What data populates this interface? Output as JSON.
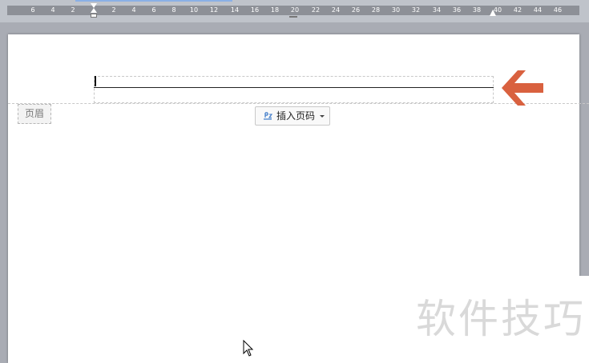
{
  "ruler": {
    "ticks": [
      "6",
      "4",
      "2",
      "2",
      "4",
      "6",
      "8",
      "10",
      "12",
      "14",
      "16",
      "18",
      "20",
      "22",
      "24",
      "26",
      "28",
      "30",
      "32",
      "34",
      "36",
      "38",
      "40",
      "42",
      "44",
      "46"
    ]
  },
  "header": {
    "tag_label": "页眉"
  },
  "insert_page_number": {
    "label": "插入页码"
  },
  "watermark": {
    "text": "软件技巧"
  },
  "colors": {
    "arrow": "#d9613f",
    "ruler_band": "#8d9097",
    "page_background": "#ffffff"
  }
}
